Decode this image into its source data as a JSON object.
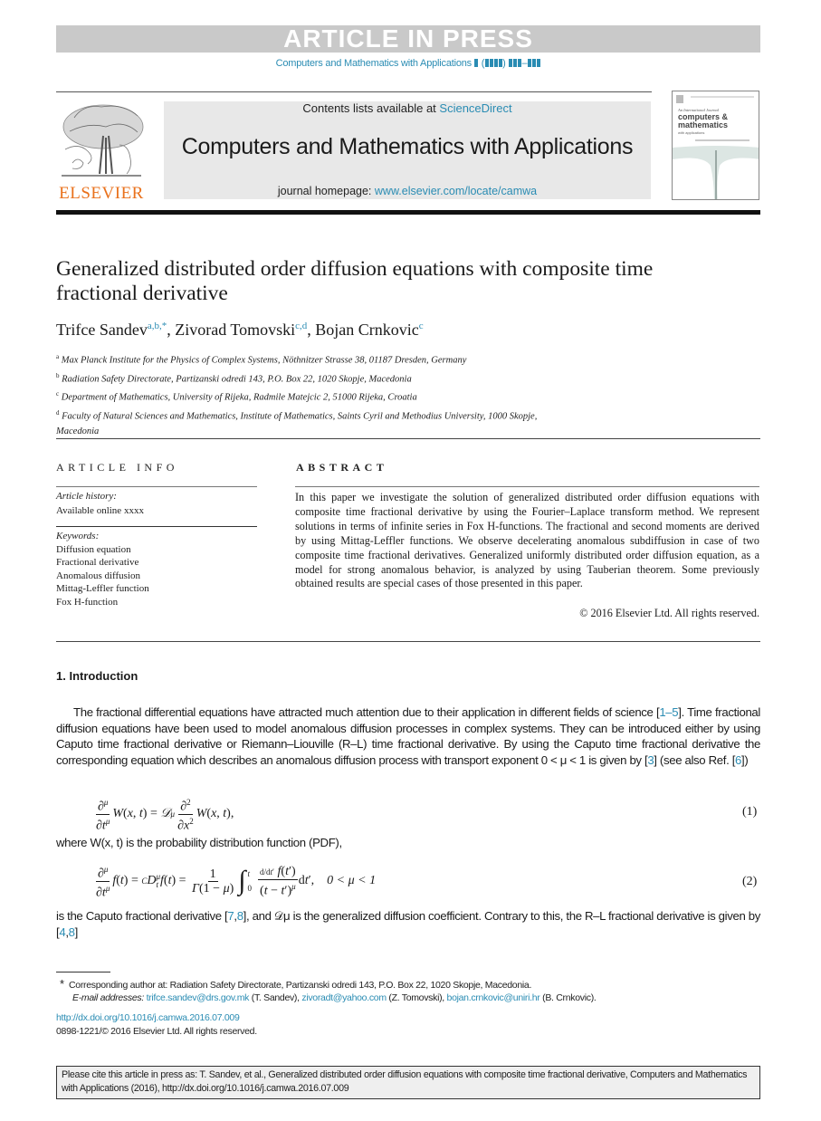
{
  "banner": {
    "text": "ARTICLE IN PRESS"
  },
  "running_header": {
    "journal": "Computers and Mathematics with Applications",
    "placeholder_volume": "(",
    "placeholder_close": ")",
    "range_sep": "–"
  },
  "masthead": {
    "publisher": "ELSEVIER",
    "contents_prefix": "Contents lists available at ",
    "contents_link": "ScienceDirect",
    "journal_title": "Computers and Mathematics with Applications",
    "homepage_prefix": "journal homepage: ",
    "homepage_link": "www.elsevier.com/locate/camwa",
    "cover": {
      "line1": "An International Journal",
      "line2": "computers &",
      "line3": "mathematics",
      "line4": "with applications"
    }
  },
  "article": {
    "title": "Generalized distributed order diffusion equations with composite time fractional derivative",
    "authors": [
      {
        "name": "Trifce Sandev",
        "affil": "a,b,*"
      },
      {
        "name": "Zivorad Tomovski",
        "affil": "c,d"
      },
      {
        "name": "Bojan Crnkovic",
        "affil": "c"
      }
    ],
    "affiliations": [
      {
        "mark": "a",
        "text": "Max Planck Institute for the Physics of Complex Systems, Nöthnitzer Strasse 38, 01187 Dresden, Germany"
      },
      {
        "mark": "b",
        "text": "Radiation Safety Directorate, Partizanski odredi 143, P.O. Box 22, 1020 Skopje, Macedonia"
      },
      {
        "mark": "c",
        "text": "Department of Mathematics, University of Rijeka, Radmile Matejcic 2, 51000 Rijeka, Croatia"
      },
      {
        "mark": "d",
        "text": "Faculty of Natural Sciences and Mathematics, Institute of Mathematics, Saints Cyril and Methodius University, 1000 Skopje, Macedonia"
      }
    ]
  },
  "article_info": {
    "heading": "ARTICLE INFO",
    "history_label": "Article history:",
    "history_value": "Available online xxxx",
    "keywords_label": "Keywords:",
    "keywords": [
      "Diffusion equation",
      "Fractional derivative",
      "Anomalous diffusion",
      "Mittag-Leffler function",
      "Fox H-function"
    ]
  },
  "abstract": {
    "heading": "ABSTRACT",
    "text": "In this paper we investigate the solution of generalized distributed order diffusion equations with composite time fractional derivative by using the Fourier–Laplace transform method. We represent solutions in terms of infinite series in Fox H-functions. The fractional and second moments are derived by using Mittag-Leffler functions. We observe decelerating anomalous subdiffusion in case of two composite time fractional derivatives. Generalized uniformly distributed order diffusion equation, as a model for strong anomalous behavior, is analyzed by using Tauberian theorem. Some previously obtained results are special cases of those presented in this paper.",
    "copyright": "© 2016 Elsevier Ltd. All rights reserved."
  },
  "body": {
    "section_heading": "1. Introduction",
    "para1_a": "The fractional differential equations have attracted much attention due to their application in different fields of science [",
    "ref_1_5": "1–5",
    "para1_b": "]. Time fractional diffusion equations have been used to model anomalous diffusion processes in complex systems. They can be introduced either by using Caputo time fractional derivative or Riemann–Liouville (R–L) time fractional derivative. By using the Caputo time fractional derivative the corresponding equation which describes an anomalous diffusion process with transport exponent 0 < μ < 1 is given by [",
    "ref_3": "3",
    "para1_c": "] (see also Ref. [",
    "ref_6": "6",
    "para1_d": "])",
    "eq1_number": "(1)",
    "where_text": "where W(x, t) is the probability distribution function (PDF),",
    "eq2_number": "(2)",
    "eq2_condition": "0 < μ < 1",
    "para2_a": "is the Caputo fractional derivative [",
    "ref_7": "7",
    "ref_8a": "8",
    "para2_b": "], and 𝒟μ is the generalized diffusion coefficient. Contrary to this, the R–L fractional derivative is given by [",
    "ref_4": "4",
    "ref_8b": "8",
    "para2_c": "]"
  },
  "footnotes": {
    "star": "*",
    "corresponding": "Corresponding author at: Radiation Safety Directorate, Partizanski odredi 143, P.O. Box 22, 1020 Skopje, Macedonia.",
    "email_label": "E-mail addresses: ",
    "emails": [
      {
        "address": "trifce.sandev@drs.gov.mk",
        "who": " (T. Sandev), "
      },
      {
        "address": "zivoradt@yahoo.com",
        "who": " (Z. Tomovski), "
      },
      {
        "address": "bojan.crnkovic@uniri.hr",
        "who": " (B. Crnkovic)."
      }
    ],
    "doi": "http://dx.doi.org/10.1016/j.camwa.2016.07.009",
    "issn": "0898-1221/© 2016 Elsevier Ltd. All rights reserved."
  },
  "citation_box": {
    "text": "Please cite this article in press as: T. Sandev, et al., Generalized distributed order diffusion equations with composite time fractional derivative, Computers and Mathematics with Applications (2016), http://dx.doi.org/10.1016/j.camwa.2016.07.009"
  },
  "colors": {
    "link": "#2a8cb3",
    "elsevier_orange": "#e9711c",
    "banner_gray": "#c9c9c9",
    "masthead_gray": "#e8e8e8"
  }
}
